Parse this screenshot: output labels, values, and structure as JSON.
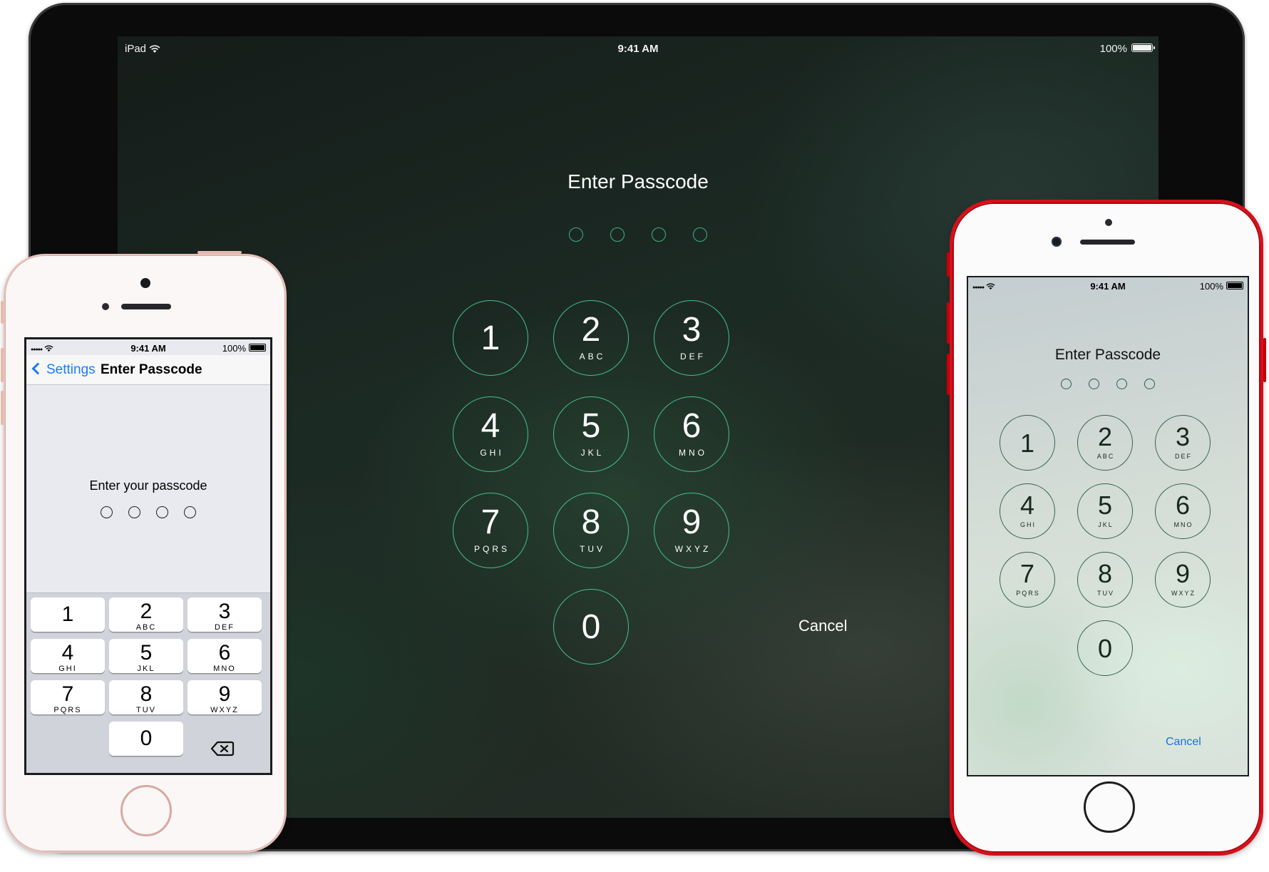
{
  "ipad": {
    "status": {
      "carrier": "iPad",
      "time": "9:41 AM",
      "battery": "100%"
    },
    "title": "Enter Passcode",
    "passcode_length": 4,
    "keypad": [
      {
        "num": "1",
        "letters": ""
      },
      {
        "num": "2",
        "letters": "ABC"
      },
      {
        "num": "3",
        "letters": "DEF"
      },
      {
        "num": "4",
        "letters": "GHI"
      },
      {
        "num": "5",
        "letters": "JKL"
      },
      {
        "num": "6",
        "letters": "MNO"
      },
      {
        "num": "7",
        "letters": "PQRS"
      },
      {
        "num": "8",
        "letters": "TUV"
      },
      {
        "num": "9",
        "letters": "WXYZ"
      },
      {
        "num": "0",
        "letters": ""
      }
    ],
    "cancel_label": "Cancel",
    "accent_color": "#44c08e"
  },
  "iphone_se": {
    "status": {
      "signal": "●●●●●",
      "time": "9:41 AM",
      "battery": "100%"
    },
    "nav": {
      "back_label": "Settings",
      "title": "Enter Passcode"
    },
    "prompt": "Enter your passcode",
    "passcode_length": 4,
    "keypad": [
      {
        "num": "1",
        "letters": ""
      },
      {
        "num": "2",
        "letters": "ABC"
      },
      {
        "num": "3",
        "letters": "DEF"
      },
      {
        "num": "4",
        "letters": "GHI"
      },
      {
        "num": "5",
        "letters": "JKL"
      },
      {
        "num": "6",
        "letters": "MNO"
      },
      {
        "num": "7",
        "letters": "PQRS"
      },
      {
        "num": "8",
        "letters": "TUV"
      },
      {
        "num": "9",
        "letters": "WXYZ"
      },
      {
        "num": "0",
        "letters": ""
      }
    ],
    "delete_icon": "backspace-icon",
    "accent_color": "#1a7cf5"
  },
  "iphone_7": {
    "status": {
      "signal": "●●●●●",
      "time": "9:41 AM",
      "battery": "100%"
    },
    "title": "Enter Passcode",
    "passcode_length": 4,
    "keypad": [
      {
        "num": "1",
        "letters": ""
      },
      {
        "num": "2",
        "letters": "ABC"
      },
      {
        "num": "3",
        "letters": "DEF"
      },
      {
        "num": "4",
        "letters": "GHI"
      },
      {
        "num": "5",
        "letters": "JKL"
      },
      {
        "num": "6",
        "letters": "MNO"
      },
      {
        "num": "7",
        "letters": "PQRS"
      },
      {
        "num": "8",
        "letters": "TUV"
      },
      {
        "num": "9",
        "letters": "WXYZ"
      },
      {
        "num": "0",
        "letters": ""
      }
    ],
    "cancel_label": "Cancel",
    "frame_color": "#d5101a"
  }
}
